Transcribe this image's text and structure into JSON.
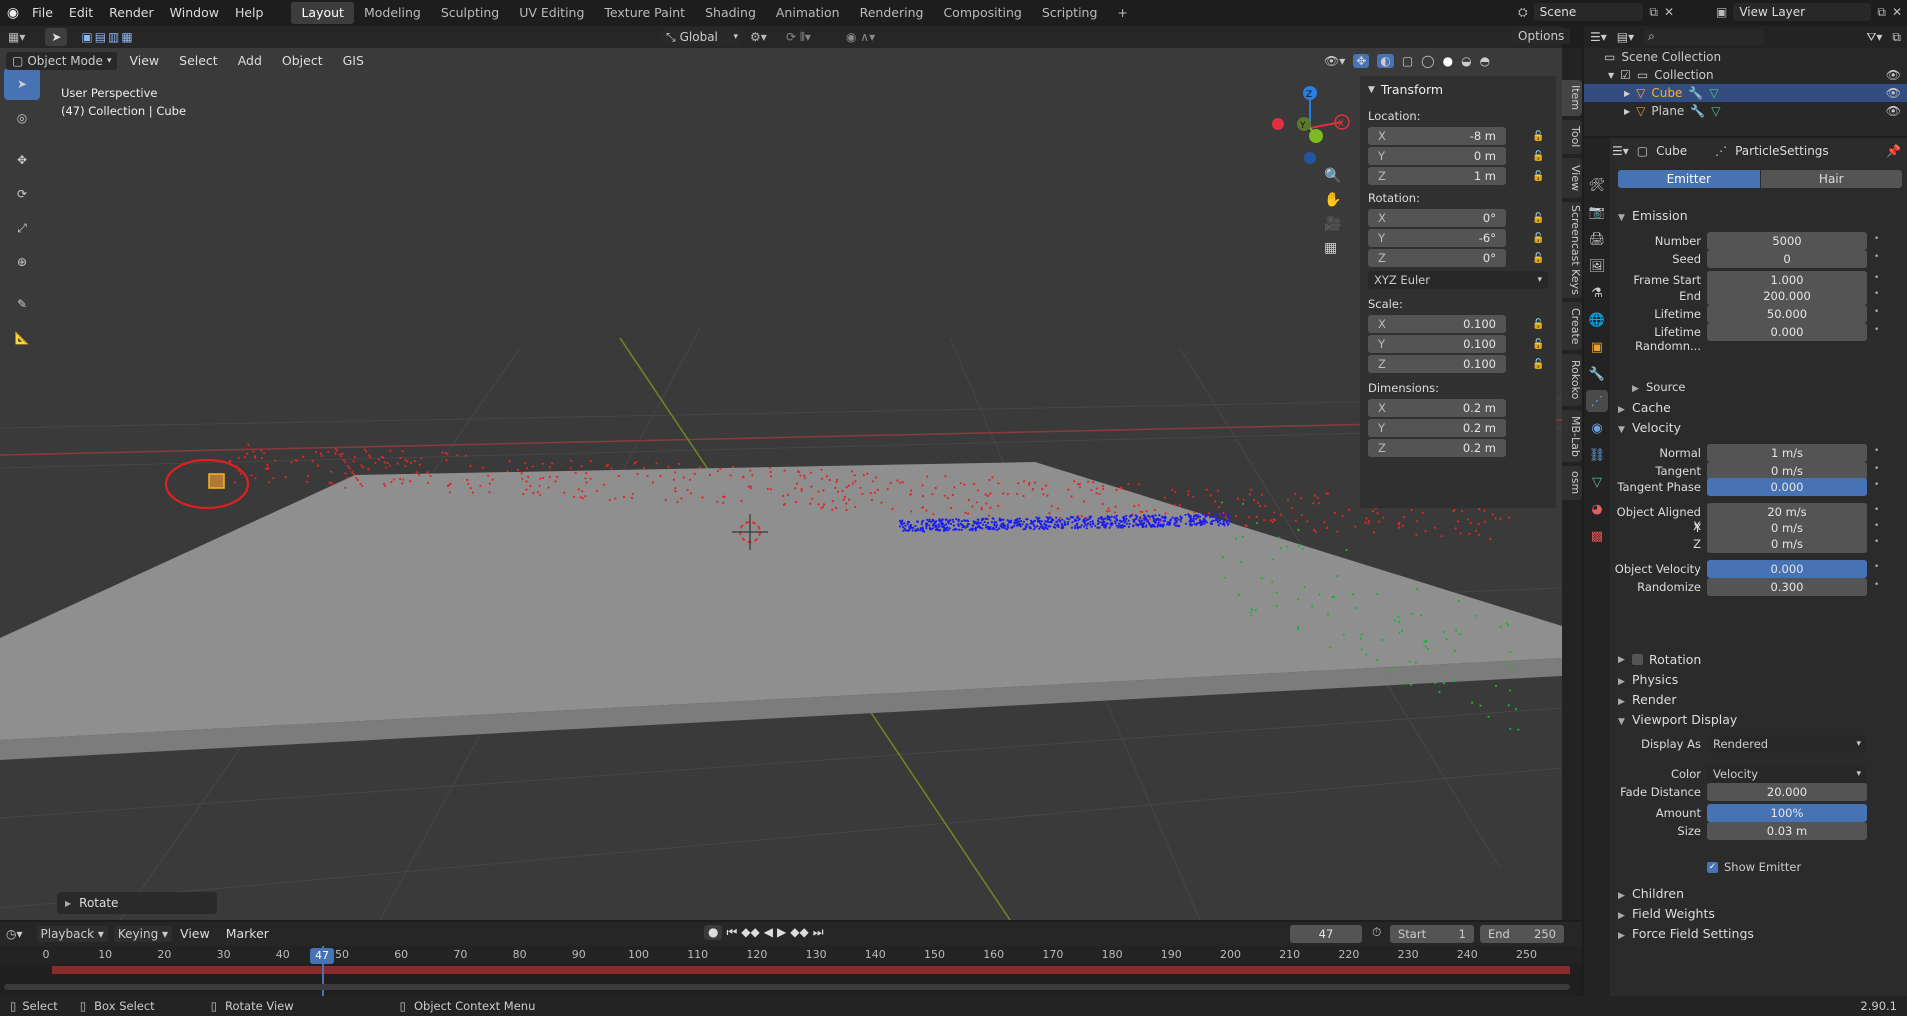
{
  "top_menu": {
    "items": [
      "File",
      "Edit",
      "Render",
      "Window",
      "Help"
    ],
    "workspaces": [
      "Layout",
      "Modeling",
      "Sculpting",
      "UV Editing",
      "Texture Paint",
      "Shading",
      "Animation",
      "Rendering",
      "Compositing",
      "Scripting"
    ],
    "add_tab": "+",
    "scene_label": "Scene",
    "view_layer_label": "View Layer"
  },
  "toolbar_header": {
    "orientation": "Global",
    "options_label": "Options"
  },
  "viewport_header": {
    "mode": "Object Mode",
    "menus": [
      "View",
      "Select",
      "Add",
      "Object",
      "GIS"
    ]
  },
  "viewport": {
    "perspective": "User Perspective",
    "collection_info": "(47) Collection | Cube",
    "last_op": "Rotate"
  },
  "gizmo": {
    "z": "Z",
    "y": "Y",
    "x": "X"
  },
  "n_panel": {
    "title": "Transform",
    "location_label": "Location:",
    "location": [
      {
        "axis": "X",
        "value": "-8 m"
      },
      {
        "axis": "Y",
        "value": "0 m"
      },
      {
        "axis": "Z",
        "value": "1 m"
      }
    ],
    "rotation_label": "Rotation:",
    "rotation": [
      {
        "axis": "X",
        "value": "0°"
      },
      {
        "axis": "Y",
        "value": "-6°"
      },
      {
        "axis": "Z",
        "value": "0°"
      }
    ],
    "rotation_mode": "XYZ Euler",
    "scale_label": "Scale:",
    "scale": [
      {
        "axis": "X",
        "value": "0.100"
      },
      {
        "axis": "Y",
        "value": "0.100"
      },
      {
        "axis": "Z",
        "value": "0.100"
      }
    ],
    "dimensions_label": "Dimensions:",
    "dimensions": [
      {
        "axis": "X",
        "value": "0.2 m"
      },
      {
        "axis": "Y",
        "value": "0.2 m"
      },
      {
        "axis": "Z",
        "value": "0.2 m"
      }
    ],
    "tabs": [
      "Item",
      "Tool",
      "View",
      "Screencast Keys",
      "Create",
      "Rokoko",
      "MB-Lab",
      "osm"
    ]
  },
  "outliner": {
    "scene_collection": "Scene Collection",
    "collection": "Collection",
    "items": [
      "Cube",
      "Plane"
    ]
  },
  "properties": {
    "object_name": "Cube",
    "settings_name": "ParticleSettings",
    "type_tabs": [
      "Emitter",
      "Hair"
    ],
    "emission_title": "Emission",
    "emission": [
      {
        "label": "Number",
        "value": "5000"
      },
      {
        "label": "Seed",
        "value": "0"
      },
      {
        "label": "Frame Start",
        "value": "1.000"
      },
      {
        "label": "End",
        "value": "200.000"
      },
      {
        "label": "Lifetime",
        "value": "50.000"
      },
      {
        "label": "Lifetime Randomn...",
        "value": "0.000"
      }
    ],
    "source_label": "Source",
    "cache_label": "Cache",
    "velocity_title": "Velocity",
    "velocity": [
      {
        "label": "Normal",
        "value": "1 m/s"
      },
      {
        "label": "Tangent",
        "value": "0 m/s"
      },
      {
        "label": "Tangent Phase",
        "value": "0.000"
      },
      {
        "label": "Object Aligned X",
        "value": "20 m/s"
      },
      {
        "label": "Y",
        "value": "0 m/s"
      },
      {
        "label": "Z",
        "value": "0 m/s"
      },
      {
        "label": "Object Velocity",
        "value": "0.000"
      },
      {
        "label": "Randomize",
        "value": "0.300"
      }
    ],
    "rotation_label": "Rotation",
    "physics_label": "Physics",
    "render_label": "Render",
    "viewport_display_title": "Viewport Display",
    "display_as_label": "Display As",
    "display_as_value": "Rendered",
    "color_label": "Color",
    "color_value": "Velocity",
    "fade_distance_label": "Fade Distance",
    "fade_distance_value": "20.000",
    "amount_label": "Amount",
    "amount_value": "100%",
    "size_label": "Size",
    "size_value": "0.03 m",
    "show_emitter_label": "Show Emitter",
    "children_label": "Children",
    "field_weights_label": "Field Weights",
    "force_field_label": "Force Field Settings"
  },
  "timeline": {
    "menus": [
      "Playback",
      "Keying",
      "View",
      "Marker"
    ],
    "current_frame": "47",
    "start_label": "Start",
    "start_value": "1",
    "end_label": "End",
    "end_value": "250",
    "ruler": [
      "0",
      "10",
      "20",
      "30",
      "40",
      "50",
      "60",
      "70",
      "80",
      "90",
      "100",
      "110",
      "120",
      "130",
      "140",
      "150",
      "160",
      "170",
      "180",
      "190",
      "200",
      "210",
      "220",
      "230",
      "240",
      "250"
    ],
    "playhead_label": "47"
  },
  "status_bar": {
    "select": "Select",
    "box_select": "Box Select",
    "rotate_view": "Rotate View",
    "context_menu": "Object Context Menu",
    "version": "2.90.1"
  },
  "colors": {
    "accent_blue": "#4772b3",
    "selection_orange": "#ffaf29",
    "annotation_red": "#e02020"
  }
}
